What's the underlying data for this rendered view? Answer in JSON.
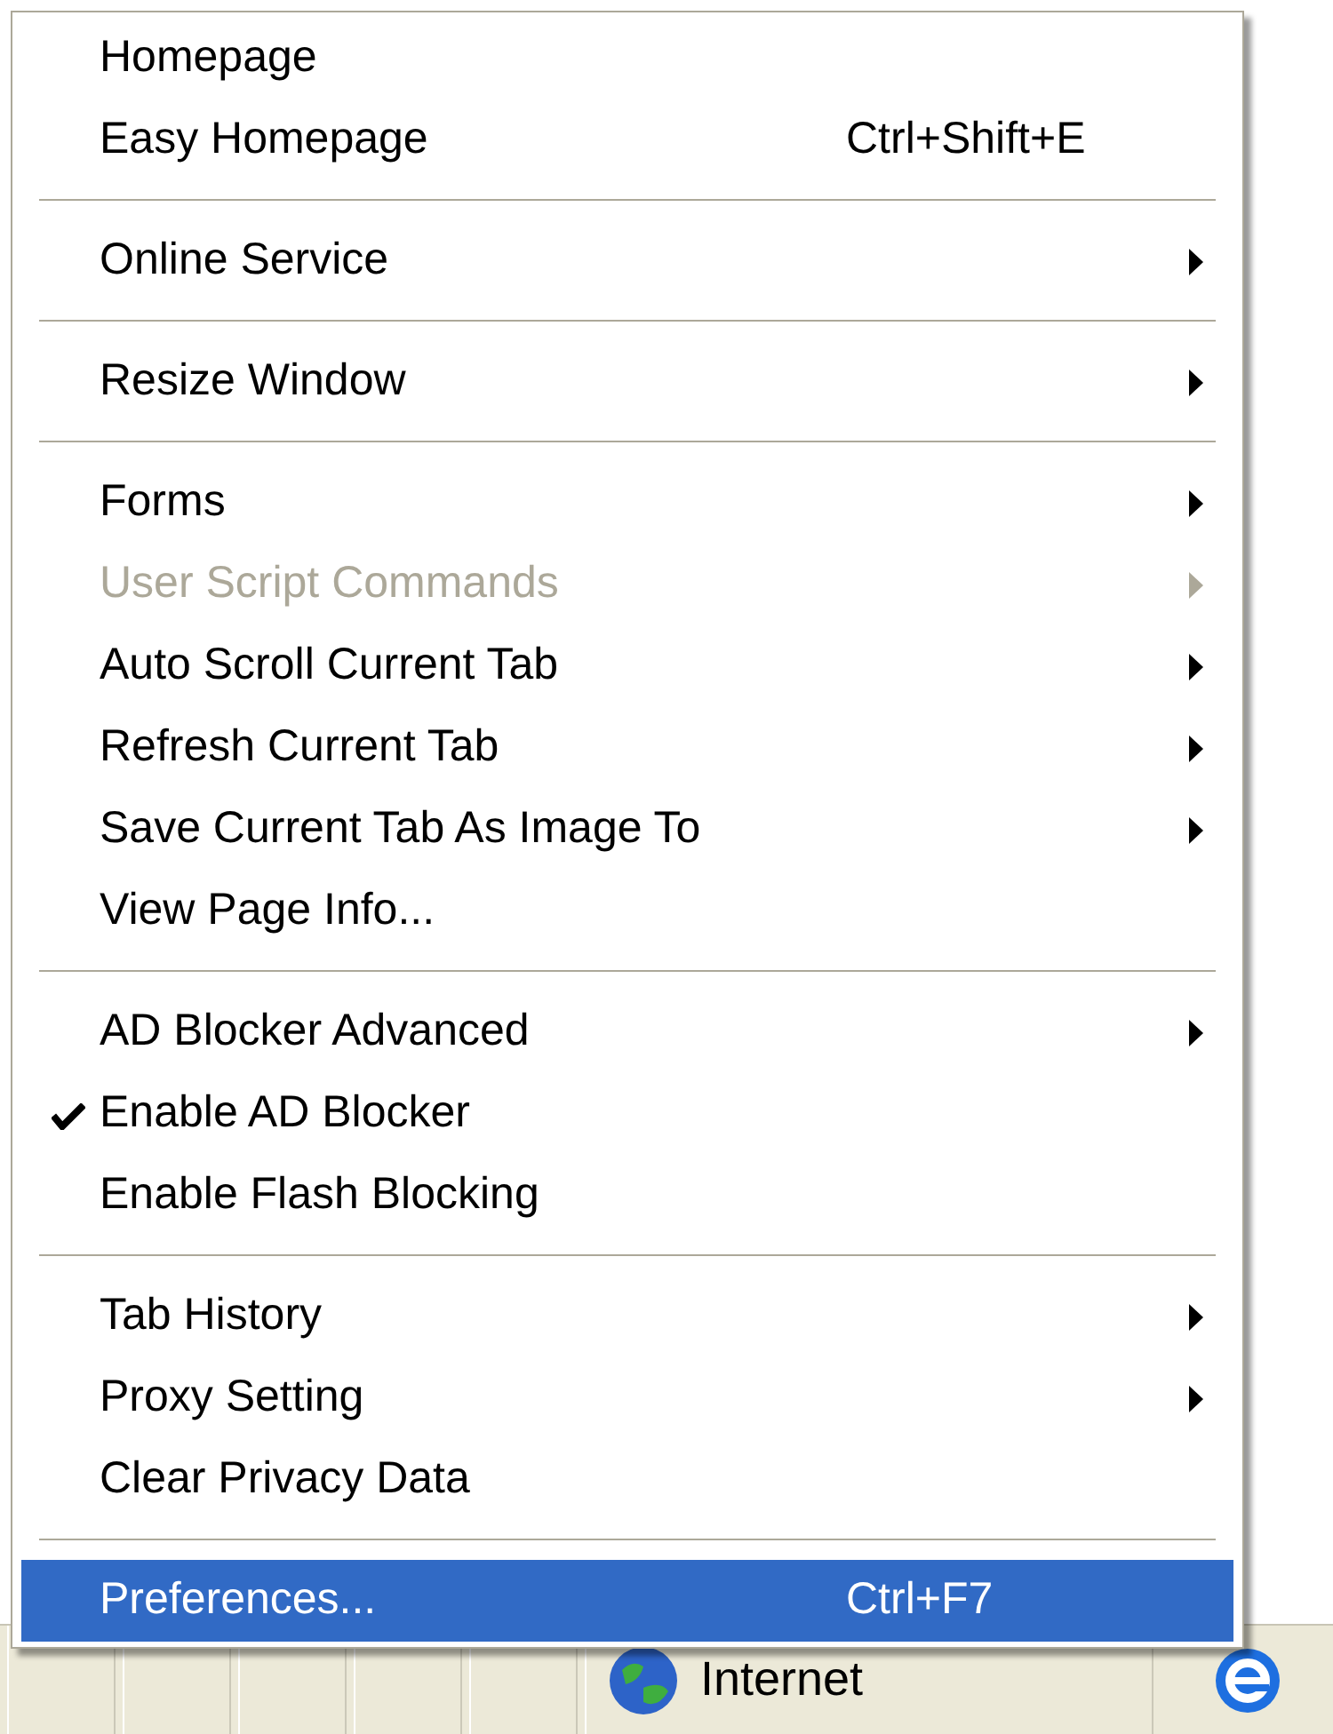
{
  "menu": {
    "sections": [
      {
        "items": [
          {
            "label": "Homepage",
            "submenu": false,
            "disabled": false,
            "checked": false,
            "selected": false
          },
          {
            "label": "Easy Homepage",
            "shortcut": "Ctrl+Shift+E",
            "submenu": false,
            "disabled": false,
            "checked": false,
            "selected": false
          }
        ]
      },
      {
        "items": [
          {
            "label": "Online Service",
            "submenu": true,
            "disabled": false,
            "checked": false,
            "selected": false
          }
        ]
      },
      {
        "items": [
          {
            "label": "Resize Window",
            "submenu": true,
            "disabled": false,
            "checked": false,
            "selected": false
          }
        ]
      },
      {
        "items": [
          {
            "label": "Forms",
            "submenu": true,
            "disabled": false,
            "checked": false,
            "selected": false
          },
          {
            "label": "User Script Commands",
            "submenu": true,
            "disabled": true,
            "checked": false,
            "selected": false
          },
          {
            "label": "Auto Scroll Current Tab",
            "submenu": true,
            "disabled": false,
            "checked": false,
            "selected": false
          },
          {
            "label": "Refresh Current Tab",
            "submenu": true,
            "disabled": false,
            "checked": false,
            "selected": false
          },
          {
            "label": "Save Current Tab As Image To",
            "submenu": true,
            "disabled": false,
            "checked": false,
            "selected": false
          },
          {
            "label": "View Page Info...",
            "submenu": false,
            "disabled": false,
            "checked": false,
            "selected": false
          }
        ]
      },
      {
        "items": [
          {
            "label": "AD Blocker Advanced",
            "submenu": true,
            "disabled": false,
            "checked": false,
            "selected": false
          },
          {
            "label": "Enable AD Blocker",
            "submenu": false,
            "disabled": false,
            "checked": true,
            "selected": false
          },
          {
            "label": "Enable Flash Blocking",
            "submenu": false,
            "disabled": false,
            "checked": false,
            "selected": false
          }
        ]
      },
      {
        "items": [
          {
            "label": "Tab History",
            "submenu": true,
            "disabled": false,
            "checked": false,
            "selected": false
          },
          {
            "label": "Proxy Setting",
            "submenu": true,
            "disabled": false,
            "checked": false,
            "selected": false
          },
          {
            "label": "Clear Privacy Data",
            "submenu": false,
            "disabled": false,
            "checked": false,
            "selected": false
          }
        ]
      },
      {
        "items": [
          {
            "label": "Preferences...",
            "shortcut": "Ctrl+F7",
            "submenu": false,
            "disabled": false,
            "checked": false,
            "selected": true
          }
        ]
      }
    ]
  },
  "status_bar": {
    "zone": "Internet"
  }
}
